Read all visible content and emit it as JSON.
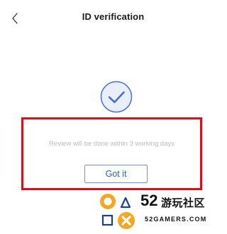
{
  "header": {
    "title": "ID verification",
    "back_icon": "chevron-left-icon"
  },
  "status": {
    "icon": "check-circle-icon",
    "message": "Review will be done within 3 working days"
  },
  "actions": {
    "got_it_label": "Got it"
  },
  "watermark": {
    "number": "52",
    "chinese": "游玩社区",
    "domain": "52GAMERS.COM"
  },
  "colors": {
    "accent": "#2d5bc9",
    "highlight_border": "#d4111b",
    "muted_text": "#b8bcc4",
    "check_circle_fill": "#e8eefb",
    "check_circle_stroke": "#4a6fd0"
  }
}
